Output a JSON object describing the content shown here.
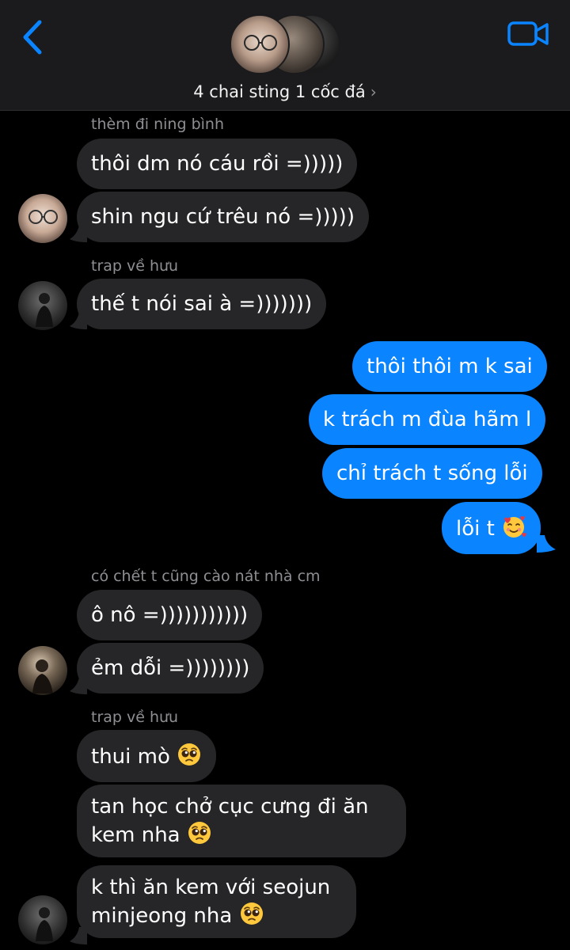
{
  "header": {
    "back_icon": "chevron-left-icon",
    "video_icon": "video-camera-icon",
    "group_name": "4 chai sting 1 cốc đá",
    "chevron": "›"
  },
  "colors": {
    "background": "#000000",
    "header_bg": "#1b1b1d",
    "incoming_bubble": "#262628",
    "outgoing_bubble": "#0a84ff",
    "accent": "#0a84ff",
    "sender_name": "#8e8e93"
  },
  "messages": {
    "m1_sender": "thèm đi ning bình",
    "m1_text": "thôi dm nó cáu rồi =)))))",
    "m2_text": "shin ngu cứ trêu nó =)))))",
    "m3_sender": "trap về hưu",
    "m3_text": "thế t nói sai à =)))))))",
    "m4_text": "thôi thôi m k sai",
    "m5_text": "k trách m đùa hãm l",
    "m6_text": "chỉ trách t sống lỗi",
    "m7_text": "lỗi t",
    "m8_sender": "có chết t cũng cào nát nhà cm",
    "m8_text": "ô nô =)))))))))))",
    "m9_text": "ẻm dỗi =))))))))",
    "m10_sender": "trap về hưu",
    "m10_text": "thui mò",
    "m11_line1": "tan học chở cục cưng đi ăn",
    "m11_line2": "kem nha",
    "m12_line1": "k thì ăn kem với seojun",
    "m12_line2": "minjeong nha"
  },
  "emoji_icons": [
    "smiling-face-with-hearts-icon",
    "pleading-face-icon"
  ]
}
